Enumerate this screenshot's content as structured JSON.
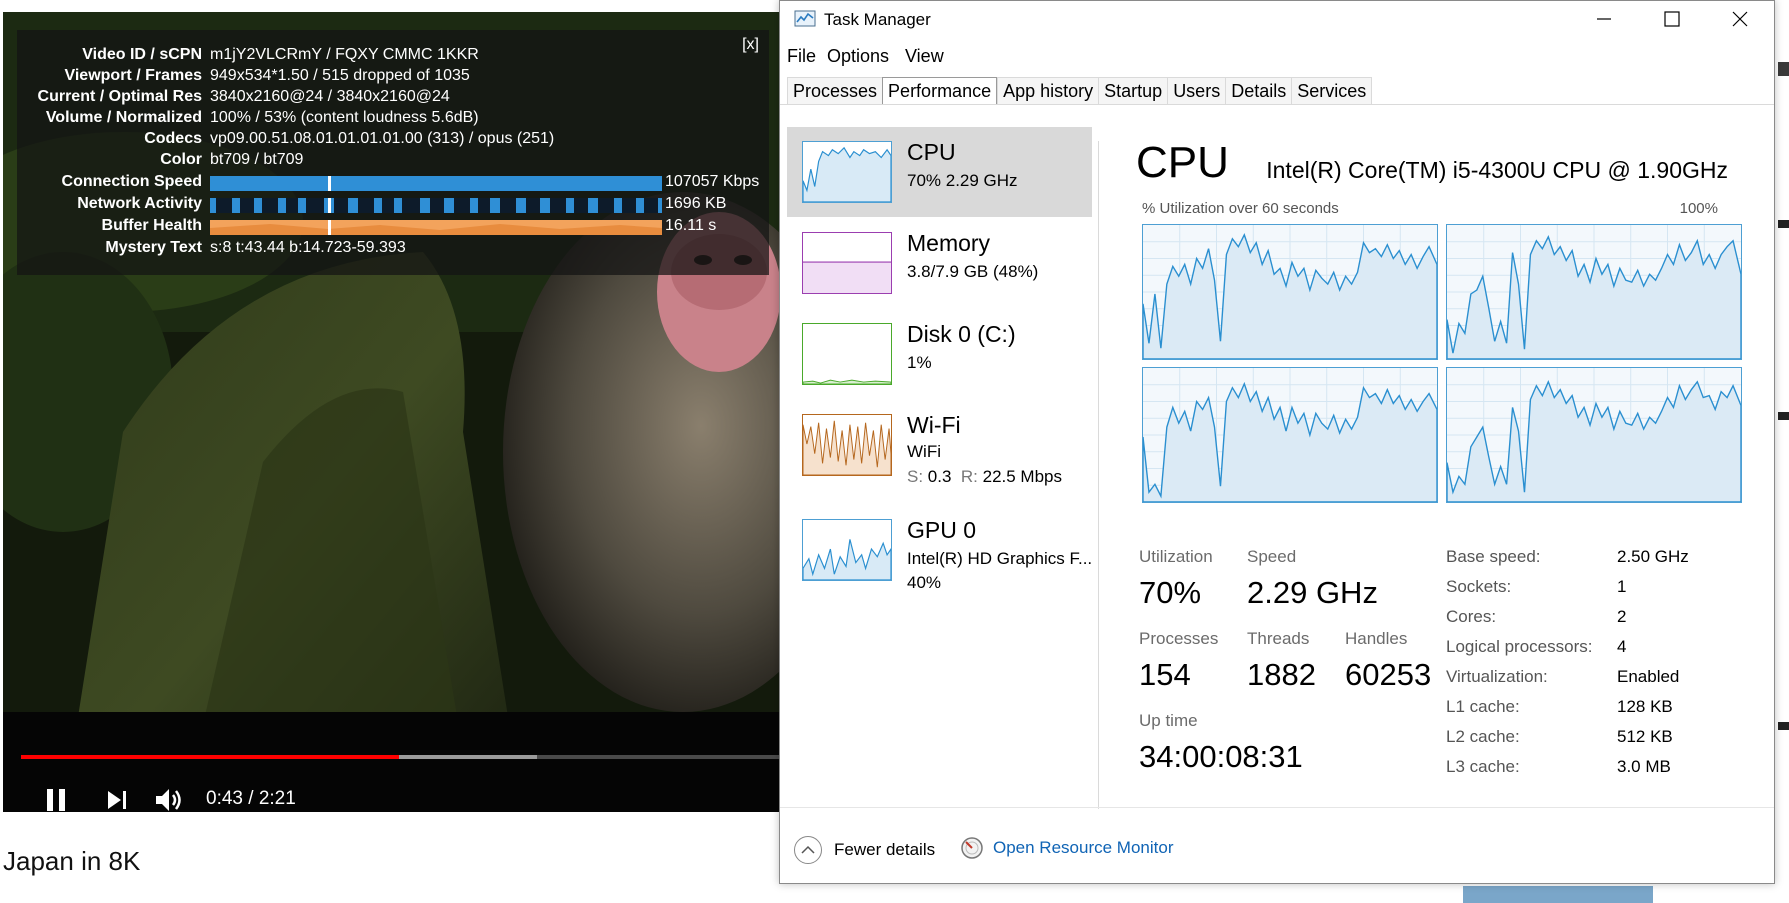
{
  "video": {
    "stats": {
      "close_label": "[x]",
      "rows": [
        {
          "label": "Video ID / sCPN",
          "value": "m1jY2VLCRmY / FQXY CMMC 1KKR"
        },
        {
          "label": "Viewport / Frames",
          "value": "949x534*1.50 / 515 dropped of 1035"
        },
        {
          "label": "Current / Optimal Res",
          "value": "3840x2160@24 / 3840x2160@24"
        },
        {
          "label": "Volume / Normalized",
          "value": "100% / 53% (content loudness 5.6dB)"
        },
        {
          "label": "Codecs",
          "value": "vp09.00.51.08.01.01.01.01.00 (313) / opus (251)"
        },
        {
          "label": "Color",
          "value": "bt709 / bt709"
        },
        {
          "label": "Connection Speed",
          "value": "107057 Kbps"
        },
        {
          "label": "Network Activity",
          "value": "1696 KB"
        },
        {
          "label": "Buffer Health",
          "value": "16.11 s"
        },
        {
          "label": "Mystery Text",
          "value": "s:8 t:43.44 b:14.723-59.393"
        }
      ]
    },
    "time": "0:43 / 2:21",
    "progress_played": 0.497,
    "progress_buffered": 0.679,
    "title": "Japan in 8K",
    "colors": {
      "played": "#ff0000",
      "bar": "#2f8fd6",
      "buffer": "#f3a35c"
    }
  },
  "task_manager": {
    "title": "Task Manager",
    "menu": [
      "File",
      "Options",
      "View"
    ],
    "tabs": [
      "Processes",
      "Performance",
      "App history",
      "Startup",
      "Users",
      "Details",
      "Services"
    ],
    "active_tab": "Performance",
    "sidebar": [
      {
        "name": "CPU",
        "line1": "70%  2.29 GHz",
        "line2": "",
        "color": "#4d9fd3"
      },
      {
        "name": "Memory",
        "line1": "3.8/7.9 GB (48%)",
        "line2": "",
        "color": "#9b3eb0"
      },
      {
        "name": "Disk 0 (C:)",
        "line1": "1%",
        "line2": "",
        "color": "#4aa92b"
      },
      {
        "name": "Wi-Fi",
        "line1": "WiFi",
        "line2_s": "S:",
        "line2_sv": "0.3",
        "line2_r": "R:",
        "line2_rv": "22.5 Mbps",
        "color": "#b5671e"
      },
      {
        "name": "GPU 0",
        "line1": "Intel(R) HD Graphics F...",
        "line2": "40%",
        "color": "#4d9fd3"
      }
    ],
    "main": {
      "heading": "CPU",
      "model": "Intel(R) Core(TM) i5-4300U CPU @ 1.90GHz",
      "axis_left": "% Utilization over 60 seconds",
      "axis_right": "100%",
      "stats": {
        "utilization_label": "Utilization",
        "utilization": "70%",
        "speed_label": "Speed",
        "speed": "2.29 GHz",
        "processes_label": "Processes",
        "processes": "154",
        "threads_label": "Threads",
        "threads": "1882",
        "handles_label": "Handles",
        "handles": "60253",
        "uptime_label": "Up time",
        "uptime": "34:00:08:31"
      },
      "specs": [
        {
          "k": "Base speed:",
          "v": "2.50 GHz"
        },
        {
          "k": "Sockets:",
          "v": "1"
        },
        {
          "k": "Cores:",
          "v": "2"
        },
        {
          "k": "Logical processors:",
          "v": "4"
        },
        {
          "k": "Virtualization:",
          "v": "Enabled"
        },
        {
          "k": "L1 cache:",
          "v": "128 KB"
        },
        {
          "k": "L2 cache:",
          "v": "512 KB"
        },
        {
          "k": "L3 cache:",
          "v": "3.0 MB"
        }
      ]
    },
    "footer": {
      "fewer_details": "Fewer details",
      "open_resource_monitor": "Open Resource Monitor"
    }
  }
}
